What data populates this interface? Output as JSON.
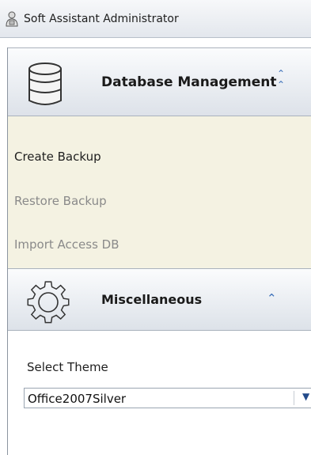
{
  "window": {
    "title": "Soft Assistant Administrator",
    "icon": "app-user-icon"
  },
  "groups": [
    {
      "title": "Database Management",
      "icon": "database-icon",
      "collapse_icon": "double-chevron-up-icon",
      "items": [
        {
          "label": "Create Backup",
          "enabled": true
        },
        {
          "label": "Restore Backup",
          "enabled": false
        },
        {
          "label": "Import Access DB",
          "enabled": false
        }
      ]
    },
    {
      "title": "Miscellaneous",
      "icon": "gear-icon",
      "collapse_icon": "double-chevron-up-icon"
    }
  ],
  "theme": {
    "label": "Select Theme",
    "selected": "Office2007Silver"
  },
  "colors": {
    "items_background": "#f4f2e2",
    "header_gradient_top": "#fbfcfd",
    "header_gradient_bottom": "#dde2e9",
    "disabled_text": "#8a8a8a",
    "chevron": "#3b6fb8"
  }
}
